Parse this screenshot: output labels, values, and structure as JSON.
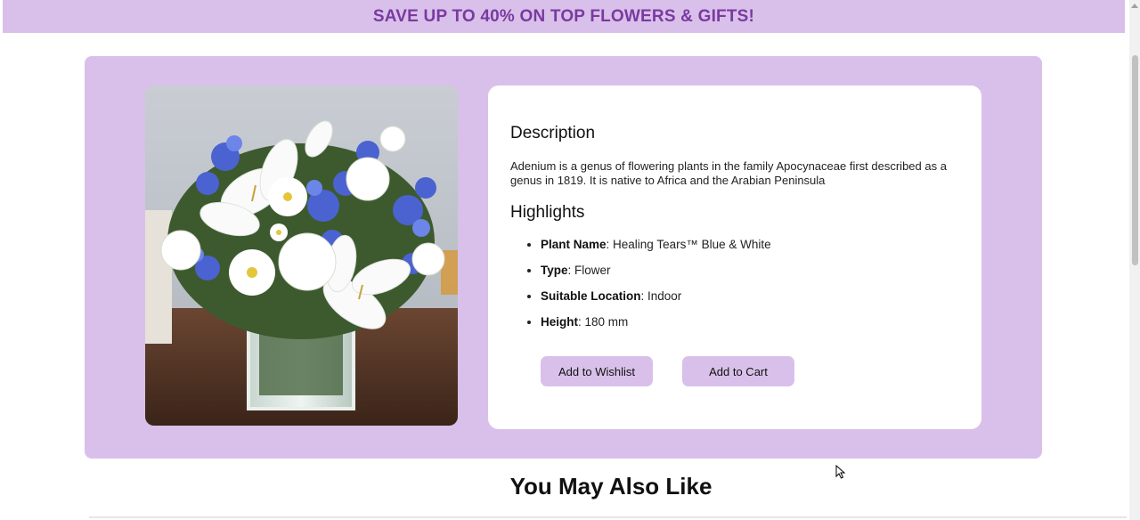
{
  "promo": {
    "text": "SAVE UP TO 40% ON TOP FLOWERS & GIFTS!"
  },
  "product": {
    "description_title": "Description",
    "description_text": "Adenium is a genus of flowering plants in the family Apocynaceae first described as a genus in 1819. It is native to Africa and the Arabian Peninsula",
    "highlights_title": "Highlights",
    "highlights": [
      {
        "label": "Plant Name",
        "value": ": Healing Tears™ Blue & White"
      },
      {
        "label": "Type",
        "value": ": Flower"
      },
      {
        "label": "Suitable Location",
        "value": ": Indoor"
      },
      {
        "label": "Height",
        "value": ": 180 mm"
      }
    ],
    "wishlist_label": "Add to Wishlist",
    "cart_label": "Add to Cart"
  },
  "also_like": {
    "title": "You May Also Like"
  },
  "colors": {
    "accent_lavender": "#d9c0ea",
    "promo_text": "#7a3aa0"
  }
}
